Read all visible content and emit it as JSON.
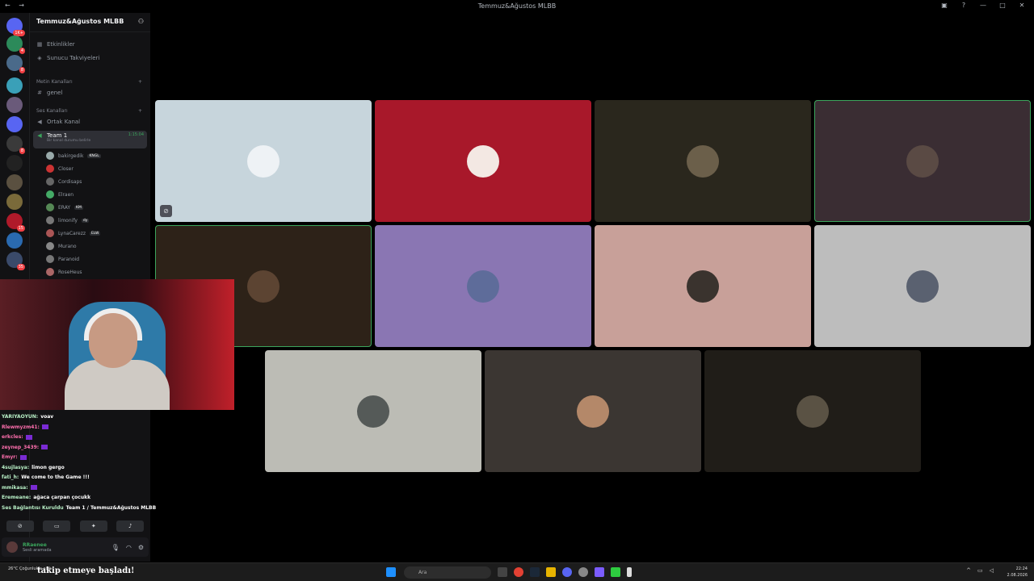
{
  "window": {
    "title": "Temmuz&Ağustos MLBB"
  },
  "server": {
    "name": "Temmuz&Ağustos MLBB",
    "top_items": [
      {
        "label": "Etkinlikler",
        "icon": "calendar-icon"
      },
      {
        "label": "Sunucu Takviyeleri",
        "icon": "boost-icon"
      }
    ],
    "text_category": "Metin Kanalları",
    "text_channels": [
      {
        "label": "genel"
      }
    ],
    "voice_category": "Ses Kanalları",
    "voice_channels": [
      {
        "label": "Ortak Kanal"
      },
      {
        "label": "Team 1",
        "timer": "1:15:04",
        "status": "Bir kanal durumu belirle"
      }
    ],
    "members": [
      {
        "name": "bakirgedik",
        "tag": "KNGL",
        "color": "#9aa"
      },
      {
        "name": "Closer",
        "tag": "",
        "color": "#c33"
      },
      {
        "name": "Cordisaps",
        "tag": "",
        "color": "#666"
      },
      {
        "name": "Elraen",
        "tag": "",
        "color": "#4a6"
      },
      {
        "name": "ERAY",
        "tag": "KM",
        "color": "#585"
      },
      {
        "name": "limonify",
        "tag": "dy",
        "color": "#777"
      },
      {
        "name": "LynaCarezz",
        "tag": "ELW",
        "color": "#a55"
      },
      {
        "name": "Murano",
        "tag": "",
        "color": "#888"
      },
      {
        "name": "Paranoid",
        "tag": "",
        "color": "#777"
      },
      {
        "name": "RoseHeus",
        "tag": "",
        "color": "#a66"
      }
    ]
  },
  "guild_badges": [
    "1K+",
    "4",
    "8",
    "8",
    "15",
    "35"
  ],
  "chat": [
    {
      "user": "YARIYAOYUN:",
      "msg": "voav",
      "style": "u"
    },
    {
      "user": "Rlewmyzm41:",
      "msg": "",
      "style": "pink"
    },
    {
      "user": "erkcles:",
      "msg": "",
      "style": "pink"
    },
    {
      "user": "zeynep_3439:",
      "msg": "",
      "style": "pink"
    },
    {
      "user": "Emyr:",
      "msg": "",
      "style": "pink"
    },
    {
      "user": "4sujlasya:",
      "msg": "limon gergo",
      "style": "u"
    },
    {
      "user": "fati_h:",
      "msg": "We come to the Game !!!",
      "style": "u"
    },
    {
      "user": "mmikasa:",
      "msg": "",
      "style": "u"
    },
    {
      "user": "Eremeane:",
      "msg": "ağaca çarpan çocukk",
      "style": "u"
    },
    {
      "user": "Ses Bağlantısı Kuruldu",
      "msg": "Team 1 / Temmuz&Ağustos MLBB",
      "style": "u"
    }
  ],
  "user": {
    "name": "RRaenee",
    "status": "Sesli aramada"
  },
  "taskbar": {
    "weather": "26°C Çoğunlukla açık",
    "overlay_text": "takip etmeye başladı!",
    "search_placeholder": "Ara",
    "time": "22:24",
    "date": "2.08.2026"
  },
  "tiles": [
    {
      "bg": "#c7d5dc",
      "avatar": "#eef2f5",
      "speaking": false,
      "muted": true
    },
    {
      "bg": "#a8182a",
      "avatar": "#f3e8e3",
      "speaking": false,
      "muted": false
    },
    {
      "bg": "#2a271d",
      "avatar": "#6b5f4a",
      "speaking": false,
      "muted": false
    },
    {
      "bg": "#3a2d33",
      "avatar": "#5a4a44",
      "speaking": true,
      "muted": false
    },
    {
      "bg": "#2d2218",
      "avatar": "#5c4432",
      "speaking": true,
      "muted": false
    },
    {
      "bg": "#8a76b3",
      "avatar": "#5e6c9a",
      "speaking": false,
      "muted": false
    },
    {
      "bg": "#c8a099",
      "avatar": "#3a332e",
      "speaking": false,
      "muted": false
    },
    {
      "bg": "#bdbdbd",
      "avatar": "#5a6170",
      "speaking": false,
      "muted": false
    },
    {
      "bg": "#bcbcb5",
      "avatar": "#555a58",
      "speaking": false,
      "muted": false
    },
    {
      "bg": "#3b3632",
      "avatar": "#b48869",
      "speaking": false,
      "muted": false
    },
    {
      "bg": "#201d18",
      "avatar": "#5a5244",
      "speaking": false,
      "muted": false
    }
  ]
}
